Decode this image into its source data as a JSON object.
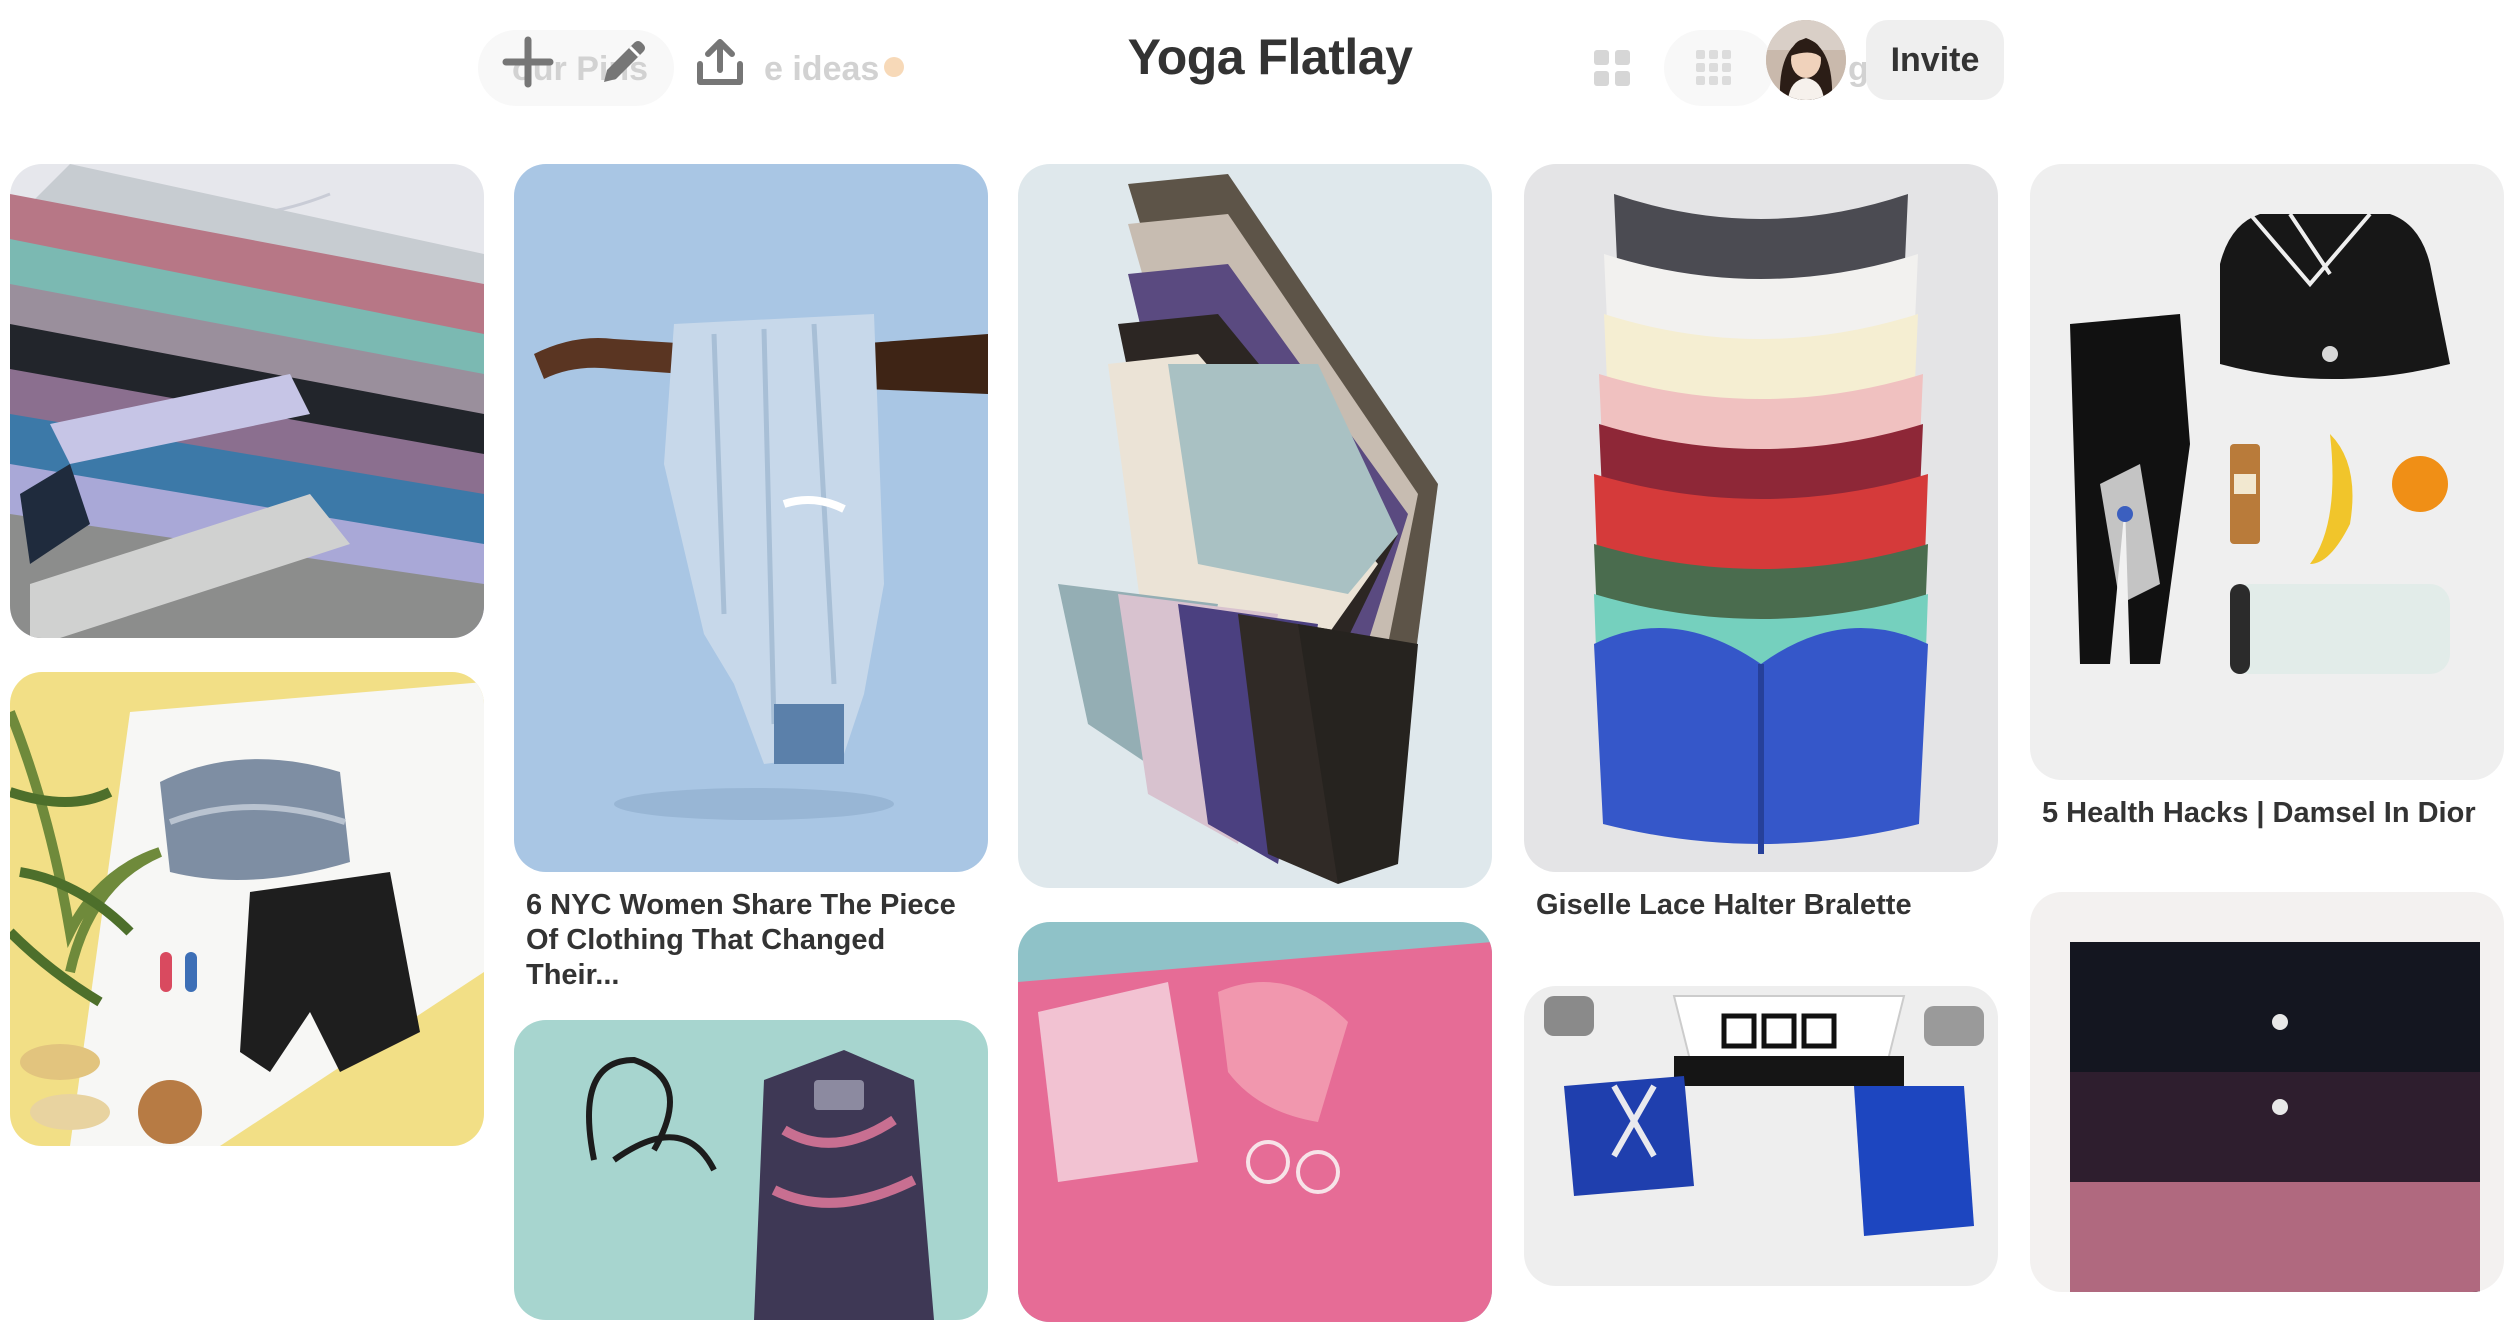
{
  "board": {
    "title": "Yoga Flatlay",
    "invite_label": "Invite",
    "ghost_tab_1": "our Pins",
    "ghost_tab_2": "e ideas",
    "ghost_tab_3": "g"
  },
  "toolbar": {
    "icons": [
      "plus-icon",
      "pencil-icon",
      "share-upload-icon"
    ],
    "view_icons": [
      "grid-default-icon",
      "grid-compact-icon"
    ]
  },
  "pins": [
    {
      "title": ""
    },
    {
      "title": ""
    },
    {
      "title": "6 NYC Women Share The Piece Of Clothing That Changed Their..."
    },
    {
      "title": ""
    },
    {
      "title": ""
    },
    {
      "title": ""
    },
    {
      "title": "Giselle Lace Halter Bralette"
    },
    {
      "title": ""
    },
    {
      "title": "5 Health Hacks | Damsel In Dior"
    },
    {
      "title": ""
    }
  ],
  "colors": {
    "title_text": "#333333",
    "invite_bg": "#efefef",
    "notification_dot": "#f7d9b8"
  }
}
